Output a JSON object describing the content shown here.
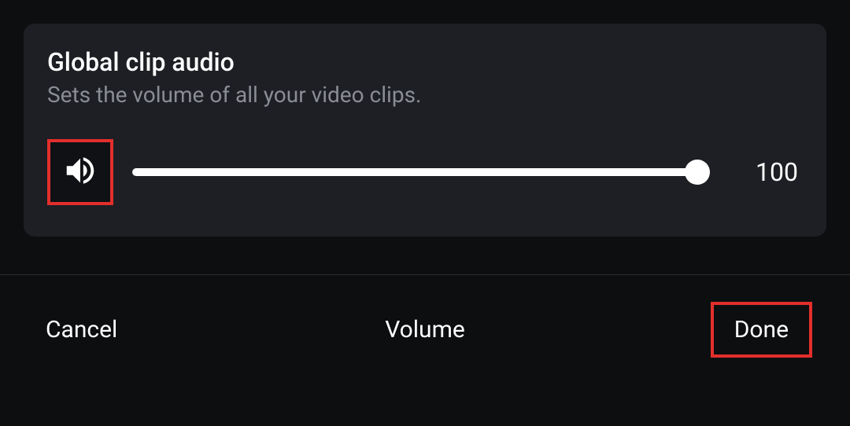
{
  "panel": {
    "title": "Global clip audio",
    "subtitle": "Sets the volume of all your video clips.",
    "volume_value": "100"
  },
  "footer": {
    "cancel_label": "Cancel",
    "title": "Volume",
    "done_label": "Done"
  }
}
